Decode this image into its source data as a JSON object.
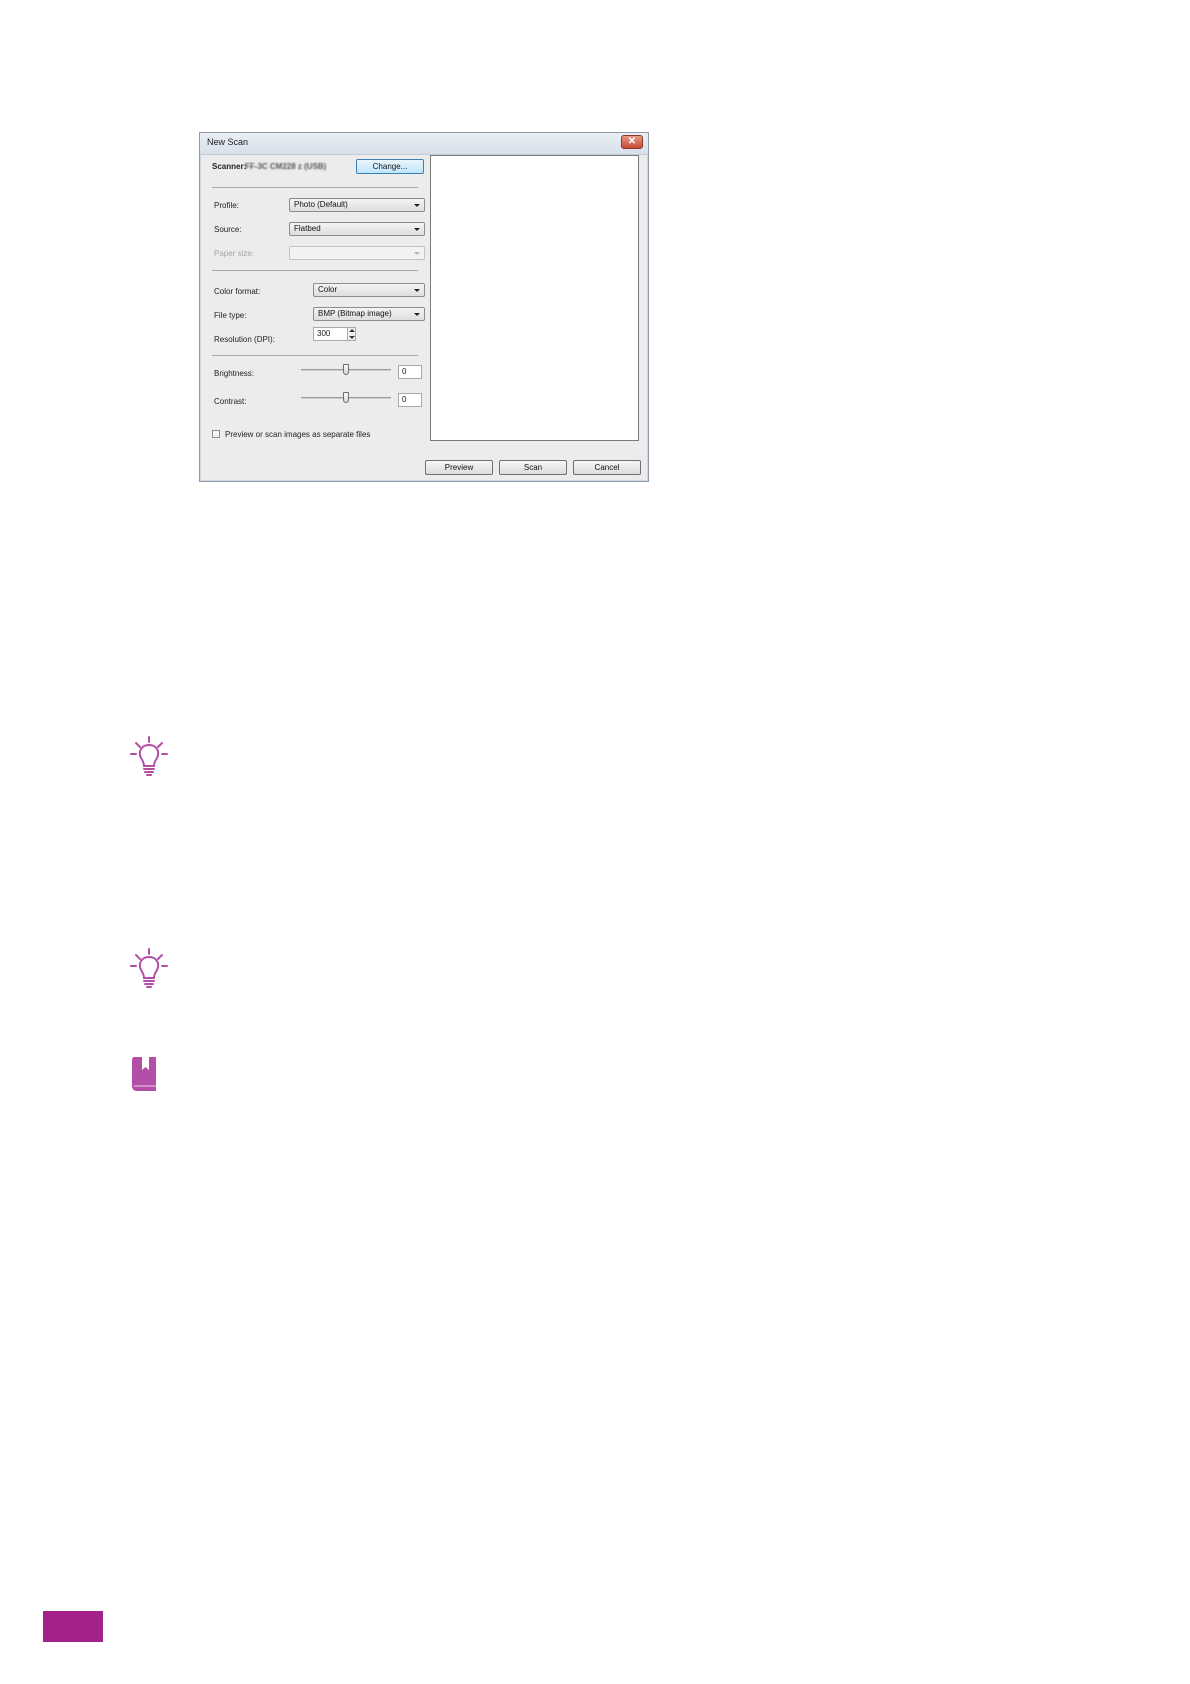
{
  "dialog": {
    "title": "New Scan",
    "close_glyph": "✕",
    "scanner_label": "Scanner:",
    "scanner_value": "FF-3C CM228 z (USB)",
    "change_button": "Change...",
    "profile": {
      "label": "Profile:",
      "value": "Photo (Default)"
    },
    "source": {
      "label": "Source:",
      "value": "Flatbed"
    },
    "paper_size": {
      "label": "Paper size:",
      "value": ""
    },
    "color_format": {
      "label": "Color format:",
      "value": "Color"
    },
    "file_type": {
      "label": "File type:",
      "value": "BMP (Bitmap image)"
    },
    "resolution": {
      "label": "Resolution (DPI):",
      "value": "300"
    },
    "brightness": {
      "label": "Brightness:",
      "value": "0",
      "level": 0.5
    },
    "contrast": {
      "label": "Contrast:",
      "value": "0",
      "level": 0.5
    },
    "separate_files": {
      "label": "Preview or scan images as separate files",
      "checked": false
    },
    "buttons": {
      "preview": "Preview",
      "scan": "Scan",
      "cancel": "Cancel"
    }
  },
  "icons": {
    "tip_1": "lightbulb-icon",
    "tip_2": "lightbulb-icon",
    "reference": "book-icon"
  },
  "colors": {
    "accent": "#a5218a",
    "icon_tint": "#b44fa8"
  }
}
